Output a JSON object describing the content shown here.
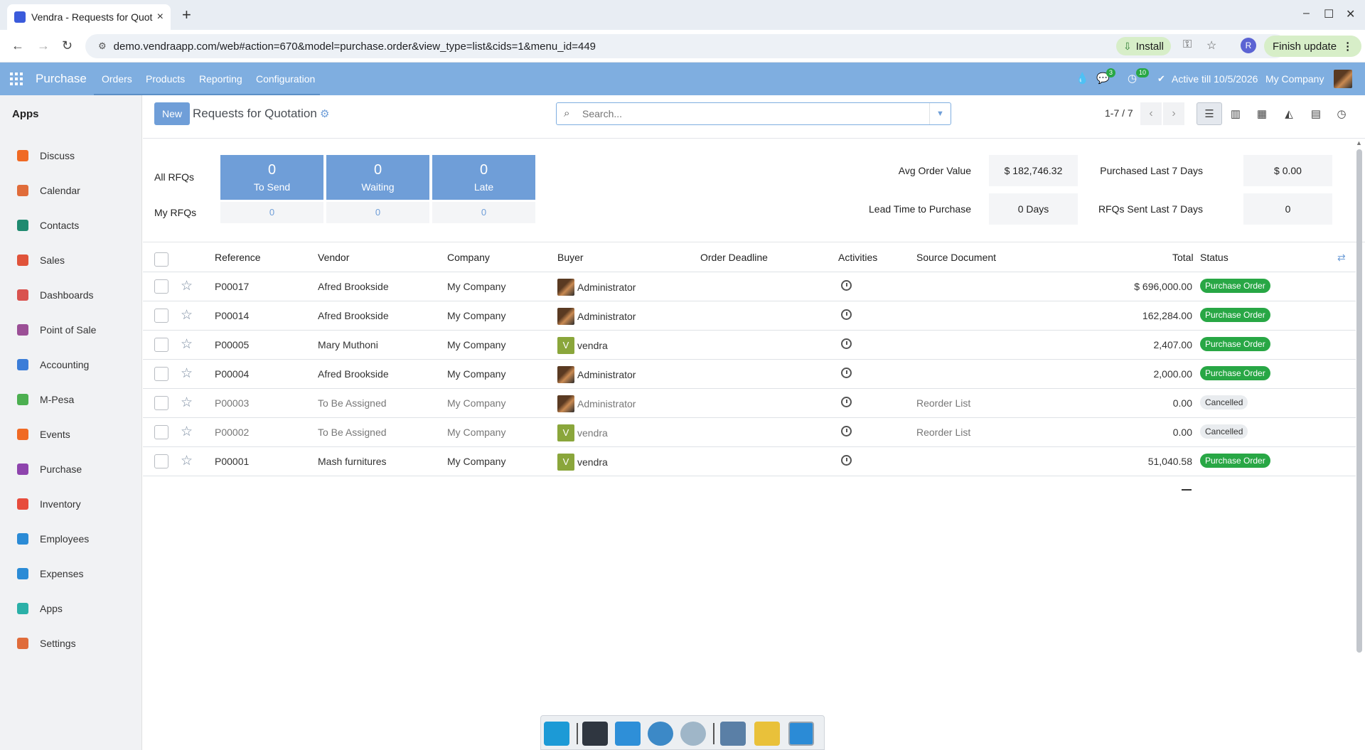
{
  "browser": {
    "tab_title": "Vendra - Requests for Quotation",
    "tab_close": "×",
    "new_tab": "+",
    "url": "demo.vendraapp.com/web#action=670&model=purchase.order&view_type=list&cids=1&menu_id=449",
    "install_label": "Install",
    "profile_initial": "R",
    "finish_update_label": "Finish update",
    "window_controls": [
      "–",
      "☐",
      "✕"
    ]
  },
  "navbar": {
    "brand": "Purchase",
    "menu": [
      "Orders",
      "Products",
      "Reporting",
      "Configuration"
    ],
    "messages_badge": "3",
    "activities_badge": "10",
    "active_till": "Active till 10/5/2026",
    "company": "My Company"
  },
  "sidebar": {
    "title": "Apps",
    "items": [
      {
        "label": "Discuss",
        "icon": "discuss-icon",
        "color": "#f06a24"
      },
      {
        "label": "Calendar",
        "icon": "calendar-icon",
        "color": "#e06c3a"
      },
      {
        "label": "Contacts",
        "icon": "contacts-icon",
        "color": "#1f8a70"
      },
      {
        "label": "Sales",
        "icon": "sales-icon",
        "color": "#e0533a"
      },
      {
        "label": "Dashboards",
        "icon": "dashboards-icon",
        "color": "#d9534f"
      },
      {
        "label": "Point of Sale",
        "icon": "pos-icon",
        "color": "#9b4f96"
      },
      {
        "label": "Accounting",
        "icon": "accounting-icon",
        "color": "#3b7dd8"
      },
      {
        "label": "M-Pesa",
        "icon": "mpesa-icon",
        "color": "#4caf50"
      },
      {
        "label": "Events",
        "icon": "events-icon",
        "color": "#f06a24"
      },
      {
        "label": "Purchase",
        "icon": "purchase-icon",
        "color": "#8e44ad"
      },
      {
        "label": "Inventory",
        "icon": "inventory-icon",
        "color": "#e74c3c"
      },
      {
        "label": "Employees",
        "icon": "employees-icon",
        "color": "#2b8bd6"
      },
      {
        "label": "Expenses",
        "icon": "expenses-icon",
        "color": "#2b8bd6"
      },
      {
        "label": "Apps",
        "icon": "apps-icon",
        "color": "#2bb0a8"
      },
      {
        "label": "Settings",
        "icon": "settings-icon",
        "color": "#e06c3a"
      }
    ]
  },
  "control": {
    "new_label": "New",
    "title": "Requests for Quotation",
    "search_placeholder": "Search...",
    "pager": "1-7 / 7"
  },
  "dashboard": {
    "all_label": "All RFQs",
    "my_label": "My RFQs",
    "tiles": [
      {
        "count": "0",
        "label": "To Send",
        "mine": "0"
      },
      {
        "count": "0",
        "label": "Waiting",
        "mine": "0"
      },
      {
        "count": "0",
        "label": "Late",
        "mine": "0"
      }
    ],
    "kpis": {
      "avg_order_label": "Avg Order Value",
      "avg_order_value": "$ 182,746.32",
      "purchased_label": "Purchased Last 7 Days",
      "purchased_value": "$ 0.00",
      "lead_time_label": "Lead Time to Purchase",
      "lead_time_value": "0 Days",
      "rfqs_sent_label": "RFQs Sent Last 7 Days",
      "rfqs_sent_value": "0"
    }
  },
  "table": {
    "columns": [
      "Reference",
      "Vendor",
      "Company",
      "Buyer",
      "Order Deadline",
      "Activities",
      "Source Document",
      "Total",
      "Status"
    ],
    "rows": [
      {
        "ref": "P00017",
        "vendor": "Afred Brookside",
        "company": "My Company",
        "buyer": "Administrator",
        "buyer_avatar": "photo",
        "source": "",
        "total": "$ 696,000.00",
        "status": "Purchase Order",
        "muted": false
      },
      {
        "ref": "P00014",
        "vendor": "Afred Brookside",
        "company": "My Company",
        "buyer": "Administrator",
        "buyer_avatar": "photo",
        "source": "",
        "total": "162,284.00",
        "status": "Purchase Order",
        "muted": false
      },
      {
        "ref": "P00005",
        "vendor": "Mary Muthoni",
        "company": "My Company",
        "buyer": "vendra",
        "buyer_avatar": "V",
        "source": "",
        "total": "2,407.00",
        "status": "Purchase Order",
        "muted": false
      },
      {
        "ref": "P00004",
        "vendor": "Afred Brookside",
        "company": "My Company",
        "buyer": "Administrator",
        "buyer_avatar": "photo",
        "source": "",
        "total": "2,000.00",
        "status": "Purchase Order",
        "muted": false
      },
      {
        "ref": "P00003",
        "vendor": "To Be Assigned",
        "company": "My Company",
        "buyer": "Administrator",
        "buyer_avatar": "photo",
        "source": "Reorder List",
        "total": "0.00",
        "status": "Cancelled",
        "muted": true
      },
      {
        "ref": "P00002",
        "vendor": "To Be Assigned",
        "company": "My Company",
        "buyer": "vendra",
        "buyer_avatar": "V",
        "source": "Reorder List",
        "total": "0.00",
        "status": "Cancelled",
        "muted": true
      },
      {
        "ref": "P00001",
        "vendor": "Mash furnitures",
        "company": "My Company",
        "buyer": "vendra",
        "buyer_avatar": "V",
        "source": "",
        "total": "51,040.58",
        "status": "Purchase Order",
        "muted": false
      }
    ]
  }
}
